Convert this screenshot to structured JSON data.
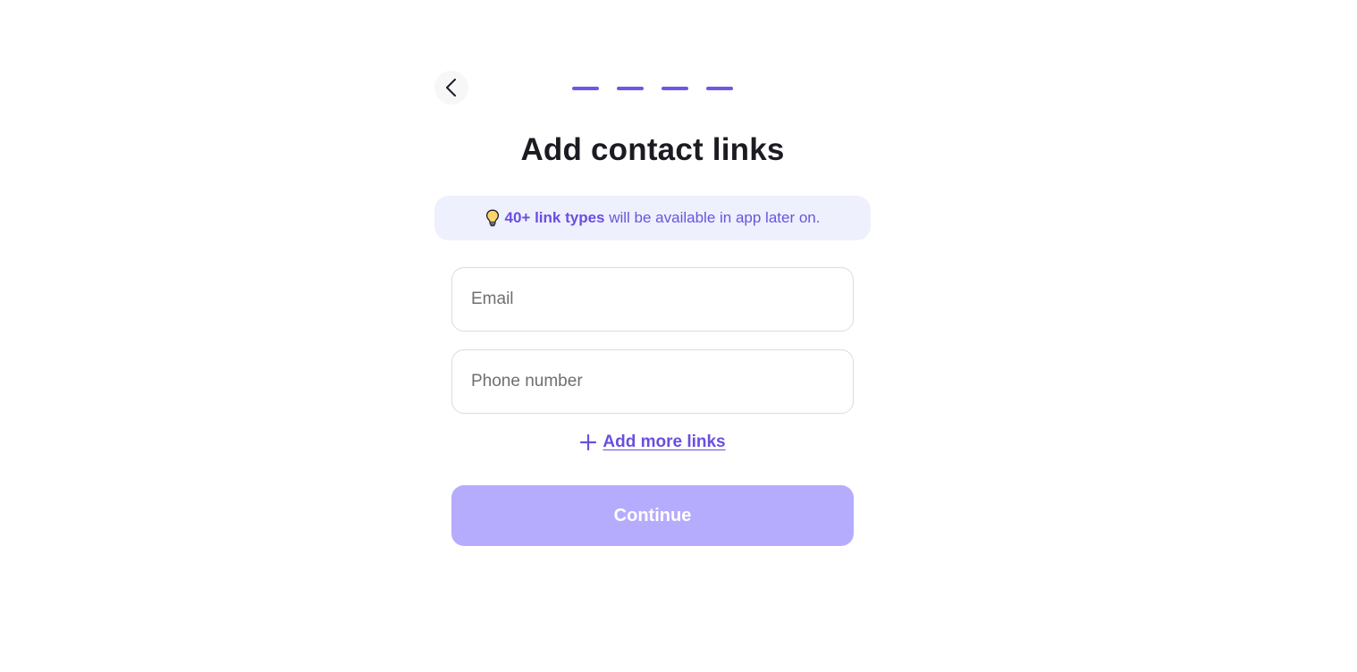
{
  "nav": {
    "back_icon": "chevron-left-icon"
  },
  "progress": {
    "steps_total": 4,
    "steps_active": 4,
    "color": "#7156e6"
  },
  "header": {
    "title": "Add contact links"
  },
  "hint": {
    "icon": "lightbulb-icon",
    "bold_text": "40+ link types",
    "rest_text": " will be available in app later on."
  },
  "form": {
    "email_placeholder": "Email",
    "email_value": "",
    "phone_placeholder": "Phone number",
    "phone_value": ""
  },
  "actions": {
    "add_more_icon": "plus-icon",
    "add_more_label": "Add more links",
    "continue_label": "Continue"
  },
  "colors": {
    "accent": "#6a4fe0",
    "continue_disabled_bg": "#b6acfd",
    "hint_bg": "#eef0fd"
  }
}
